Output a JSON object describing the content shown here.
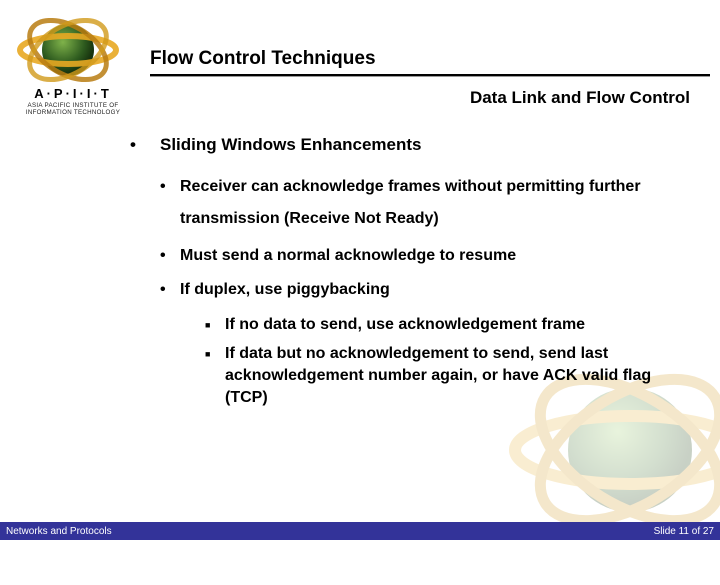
{
  "header": {
    "title": "Flow Control Techniques",
    "subtitle": "Data Link and Flow Control"
  },
  "logo": {
    "acronym": "A·P·I·I·T",
    "subtitle": "ASIA PACIFIC INSTITUTE OF INFORMATION TECHNOLOGY"
  },
  "content": {
    "heading": "Sliding Windows Enhancements",
    "points": {
      "p1": "Receiver can acknowledge frames without permitting further transmission (Receive Not Ready)",
      "p2": "Must send a normal acknowledge to resume",
      "p3": "If duplex, use piggybacking"
    },
    "subpoints": {
      "s1": "If no data to send, use acknowledgement frame",
      "s2": "If data but no acknowledgement to send, send last acknowledgement number again, or have ACK valid flag (TCP)"
    }
  },
  "footer": {
    "left": "Networks and Protocols",
    "right": "Slide 11 of 27"
  }
}
